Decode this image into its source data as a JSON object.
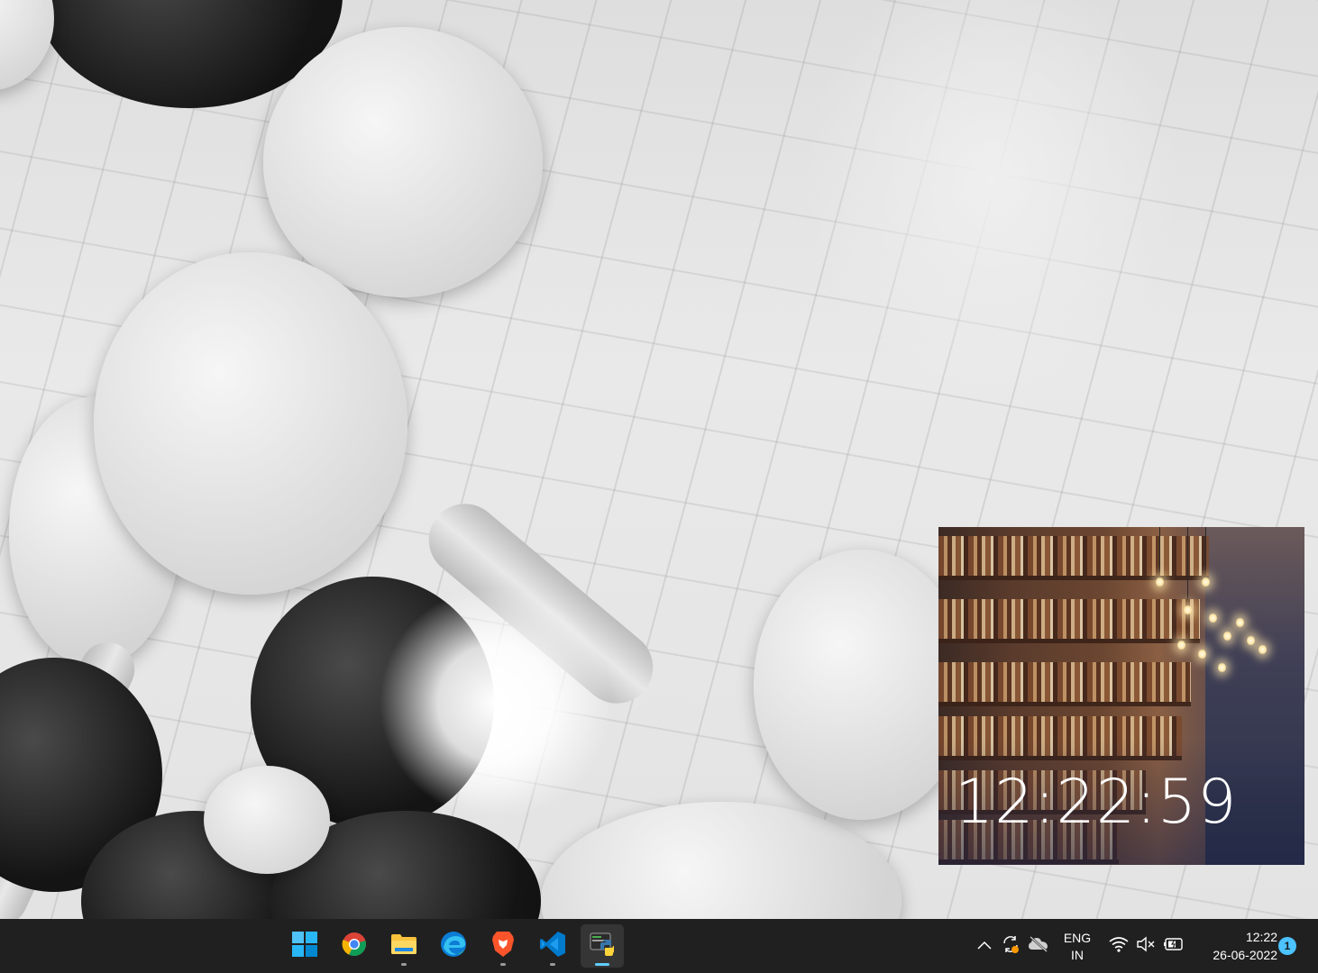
{
  "desktop": {
    "wallpaper": "black-and-white-balloons-wallpaper"
  },
  "clock_widget": {
    "time": "12:22:59",
    "background": "library-bookshelves-image"
  },
  "taskbar": {
    "apps": [
      {
        "name": "Start",
        "icon": "windows-start-icon",
        "running": false,
        "active": false
      },
      {
        "name": "Google Chrome",
        "icon": "chrome-icon",
        "running": false,
        "active": false
      },
      {
        "name": "File Explorer",
        "icon": "file-explorer-icon",
        "running": true,
        "active": false
      },
      {
        "name": "Microsoft Edge",
        "icon": "edge-icon",
        "running": false,
        "active": false
      },
      {
        "name": "Brave",
        "icon": "brave-icon",
        "running": true,
        "active": false
      },
      {
        "name": "Visual Studio Code",
        "icon": "vscode-icon",
        "running": true,
        "active": false
      },
      {
        "name": "Python",
        "icon": "python-icon",
        "running": true,
        "active": true
      }
    ],
    "tray": {
      "overflow_icon": "chevron-up-icon",
      "sync_icon": "sync-icon",
      "onedrive_icon": "onedrive-offline-icon",
      "language_line1": "ENG",
      "language_line2": "IN",
      "wifi_icon": "wifi-icon",
      "volume_icon": "volume-muted-icon",
      "battery_icon": "battery-charging-icon",
      "time": "12:22",
      "date": "26-06-2022",
      "notification_count": "1"
    },
    "colors": {
      "background": "#202020",
      "accent": "#60cdff"
    }
  }
}
